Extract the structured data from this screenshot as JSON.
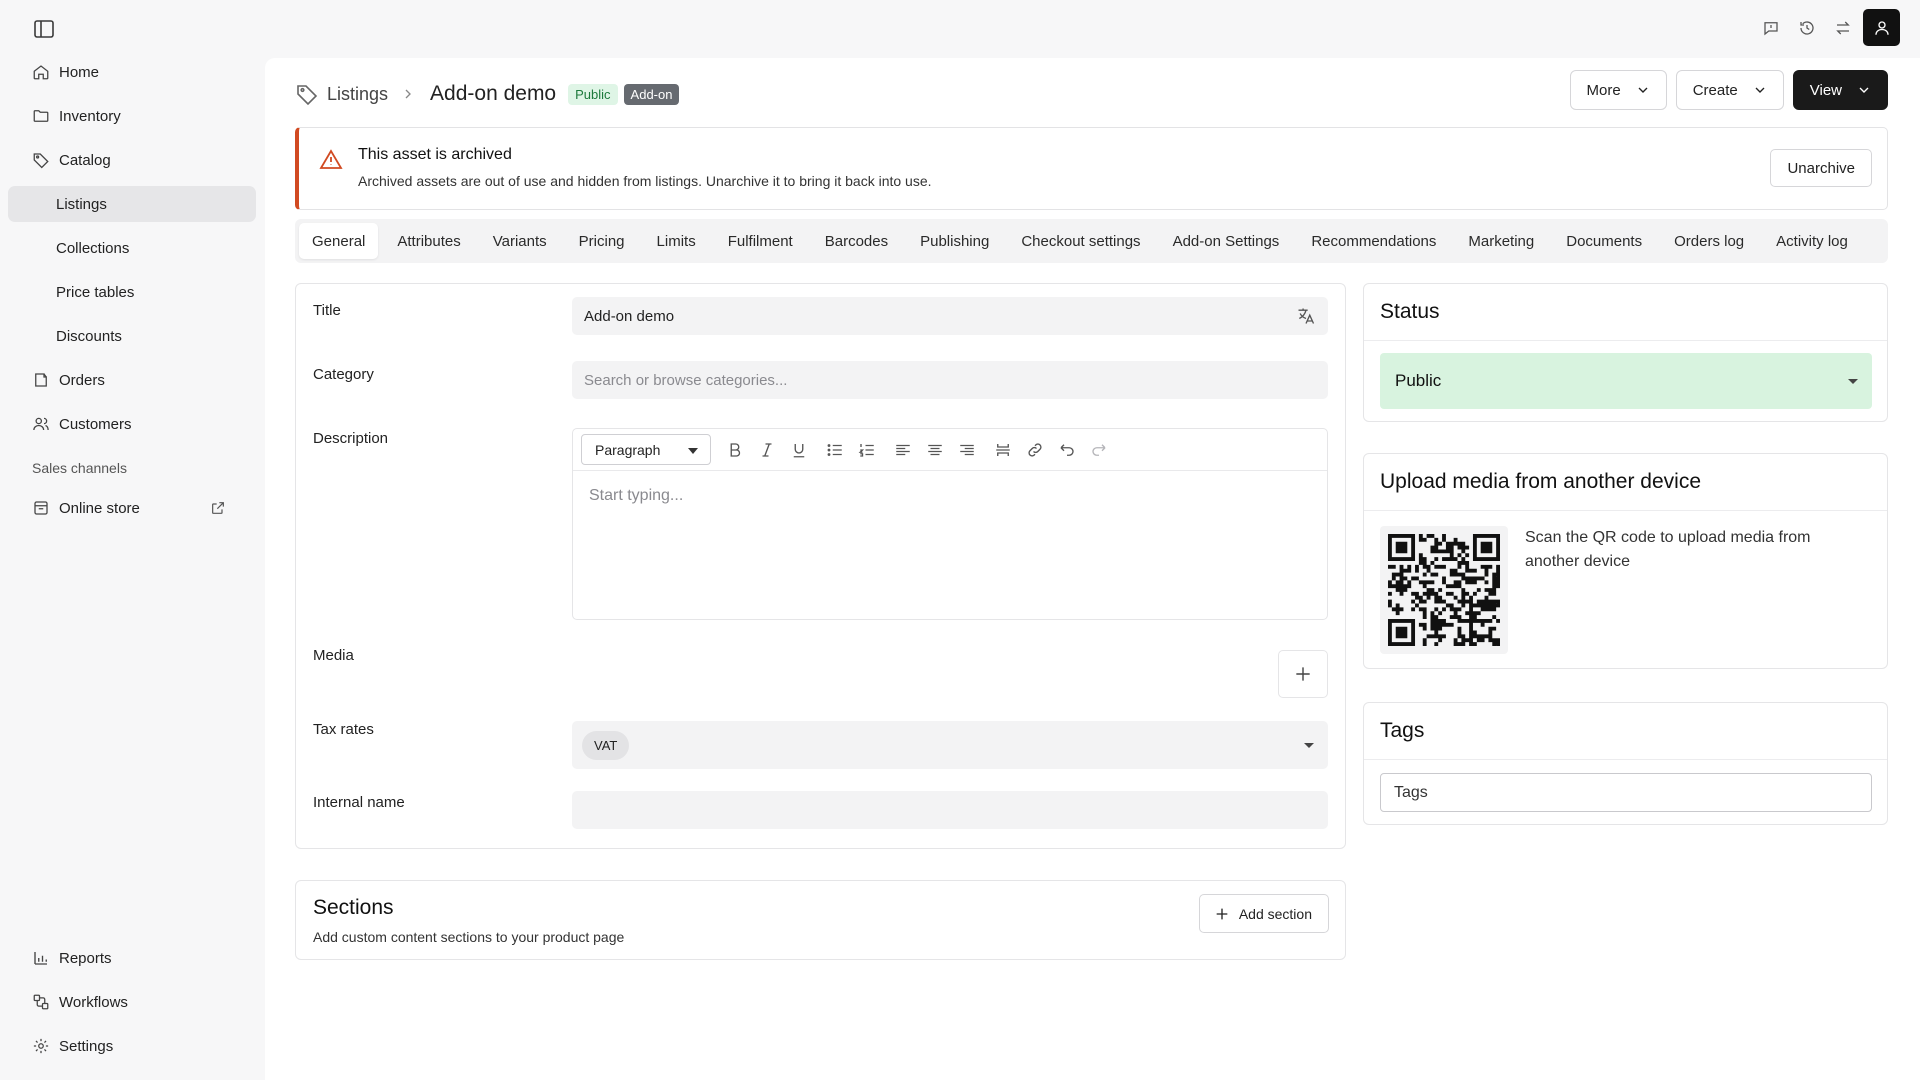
{
  "sidebar": {
    "nav": [
      {
        "label": "Home"
      },
      {
        "label": "Inventory"
      },
      {
        "label": "Catalog"
      },
      {
        "label": "Listings"
      },
      {
        "label": "Collections"
      },
      {
        "label": "Price tables"
      },
      {
        "label": "Discounts"
      },
      {
        "label": "Orders"
      },
      {
        "label": "Customers"
      }
    ],
    "channels_title": "Sales channels",
    "channels": [
      {
        "label": "Online store"
      }
    ],
    "bottom": [
      {
        "label": "Reports"
      },
      {
        "label": "Workflows"
      },
      {
        "label": "Settings"
      }
    ]
  },
  "header": {
    "breadcrumb": "Listings",
    "title": "Add-on demo",
    "badges": [
      "Public",
      "Add-on"
    ],
    "actions": {
      "more": "More",
      "create": "Create",
      "view": "View"
    }
  },
  "alert": {
    "title": "This asset is archived",
    "text": "Archived assets are out of use and hidden from listings. Unarchive it to bring it back into use.",
    "button": "Unarchive"
  },
  "tabs": [
    "General",
    "Attributes",
    "Variants",
    "Pricing",
    "Limits",
    "Fulfilment",
    "Barcodes",
    "Publishing",
    "Checkout settings",
    "Add-on Settings",
    "Recommendations",
    "Marketing",
    "Documents",
    "Orders log",
    "Activity log"
  ],
  "form": {
    "title_label": "Title",
    "title_value": "Add-on demo",
    "category_label": "Category",
    "category_placeholder": "Search or browse categories...",
    "description_label": "Description",
    "paragraph": "Paragraph",
    "editor_placeholder": "Start typing...",
    "media_label": "Media",
    "tax_label": "Tax rates",
    "tax_value": "VAT",
    "internal_name_label": "Internal name",
    "internal_name_value": ""
  },
  "sections": {
    "title": "Sections",
    "subtitle": "Add custom content sections to your product page",
    "button": "Add section"
  },
  "status": {
    "title": "Status",
    "value": "Public"
  },
  "upload": {
    "title": "Upload media from another device",
    "text": "Scan the QR code to upload media from another device"
  },
  "tags": {
    "title": "Tags",
    "placeholder": "Tags"
  },
  "colors": {
    "accent_dark": "#1a1a1a",
    "alert": "#d14a22",
    "status_bg": "#d8f3df"
  }
}
